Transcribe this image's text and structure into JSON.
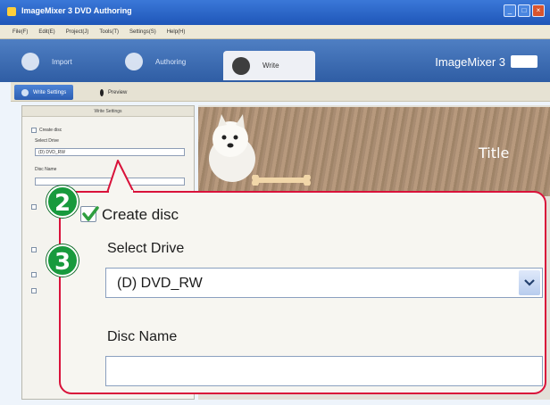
{
  "window": {
    "title": "ImageMixer 3 DVD Authoring",
    "brand": "ImageMixer 3"
  },
  "menu": {
    "items": [
      "File(F)",
      "Edit(E)",
      "Project(J)",
      "Tools(T)",
      "Settings(S)",
      "Help(H)"
    ]
  },
  "modes": {
    "import": "Import",
    "authoring": "Authoring",
    "write": "Write"
  },
  "subtabs": {
    "write_settings": "Write Settings",
    "preview": "Preview"
  },
  "settings_panel": {
    "header": "Write Settings",
    "create_disc": "Create disc",
    "select_drive": "Select Drive",
    "drive_value": "(D) DVD_RW",
    "disc_name": "Disc Name"
  },
  "preview": {
    "menu_title": "Title"
  },
  "callout": {
    "step2": "2",
    "step3": "3",
    "create_disc_label": "Create disc",
    "create_disc_checked": true,
    "select_drive_label": "Select Drive",
    "drive_value": "(D) DVD_RW",
    "disc_name_label": "Disc Name",
    "disc_name_value": ""
  },
  "colors": {
    "callout_border": "#d9123a",
    "step_badge": "#189a3d",
    "check": "#2f9e3f"
  }
}
